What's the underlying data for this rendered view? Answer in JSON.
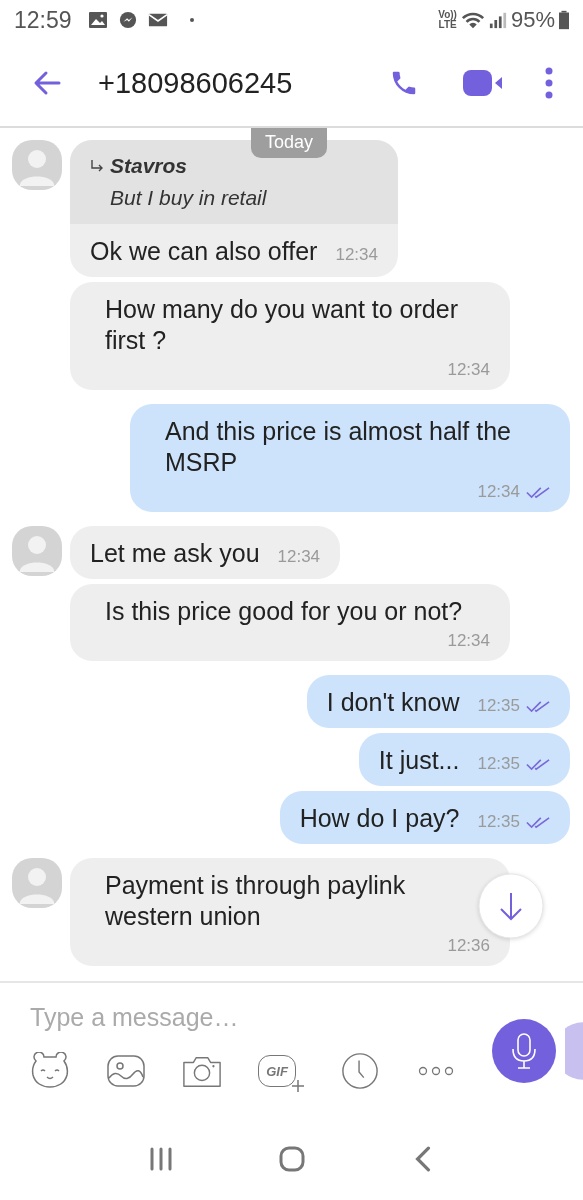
{
  "status_bar": {
    "time": "12:59",
    "network_labels": [
      "Vo))",
      "LTE"
    ],
    "battery": "95%"
  },
  "header": {
    "title": "+18098606245"
  },
  "date_badge": "Today",
  "messages": [
    {
      "kind": "in",
      "avatar": true,
      "quote": {
        "author": "Stavros",
        "text": "But I buy in retail"
      },
      "text": "Ok we can also offer",
      "time": "12:34"
    },
    {
      "kind": "in",
      "avatar": false,
      "text": "How many do you want to order first ?",
      "time": "12:34"
    },
    {
      "kind": "out",
      "text": "And this price is almost half the MSRP",
      "time": "12:34",
      "read": true
    },
    {
      "kind": "in",
      "avatar": true,
      "text": "Let me ask you",
      "time": "12:34"
    },
    {
      "kind": "in",
      "avatar": false,
      "text": "Is this price good for you or not?",
      "time": "12:34"
    },
    {
      "kind": "out",
      "text": "I don't know",
      "time": "12:35",
      "read": true
    },
    {
      "kind": "out",
      "text": "It just...",
      "time": "12:35",
      "read": true
    },
    {
      "kind": "out",
      "text": "How do I pay?",
      "time": "12:35",
      "read": true
    },
    {
      "kind": "in",
      "avatar": true,
      "text": "Payment is through paylink western union",
      "time": "12:36"
    }
  ],
  "composer": {
    "placeholder": "Type a message…",
    "gif_label": "GIF"
  }
}
